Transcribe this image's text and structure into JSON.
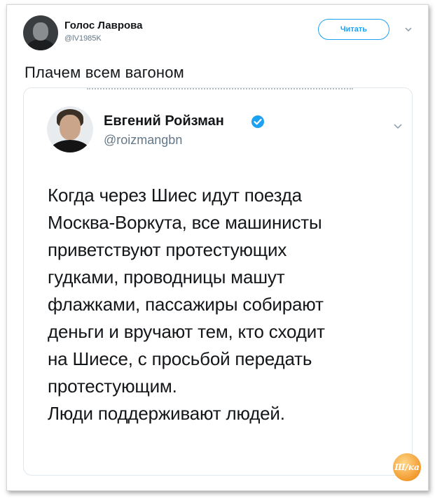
{
  "outer_tweet": {
    "author_name": "Голос Лаврова",
    "author_handle": "@lV1985K",
    "follow_label": "Читать",
    "text": "Плачем всем вагоном"
  },
  "quoted_tweet": {
    "author_name": "Евгений Ройзман",
    "author_handle": "@roizmangbn",
    "verified": true,
    "text_lines": [
      "Когда через Шиес идут поезда",
      "Москва-Воркута, все машинисты",
      "приветствуют протестующих",
      "гудками, проводницы машут",
      "флажками, пассажиры собирают",
      "деньги и вручают тем, кто сходит",
      "на Шиесе, с просьбой передать",
      "протестующим.",
      "Люди поддерживают людей."
    ]
  },
  "watermark": {
    "text": "Ш/ка"
  },
  "colors": {
    "accent": "#1da1f2",
    "text": "#14171a",
    "secondary": "#657786",
    "border": "#e1e8ed"
  }
}
